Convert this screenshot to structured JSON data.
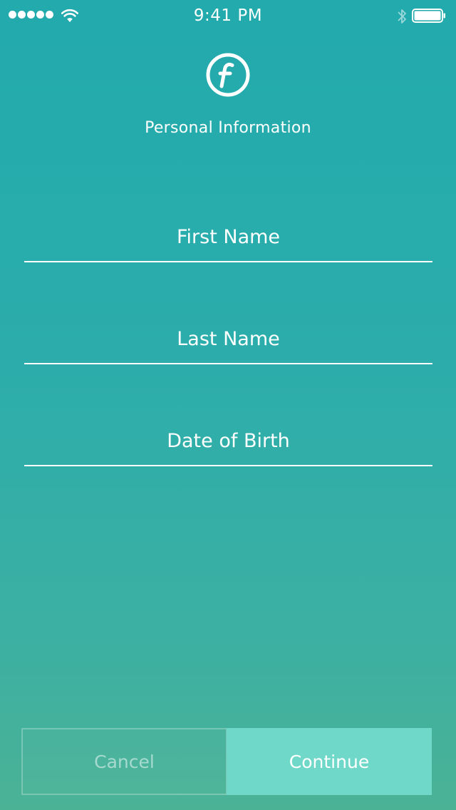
{
  "status_bar": {
    "time": "9:41 PM",
    "signal_icon": "signal-dots-icon",
    "wifi_icon": "wifi-icon",
    "bluetooth_icon": "bluetooth-icon",
    "battery_icon": "battery-icon"
  },
  "header": {
    "logo_icon": "f-circle-logo-icon",
    "title": "Personal Information"
  },
  "form": {
    "first_name": {
      "placeholder": "First Name",
      "value": ""
    },
    "last_name": {
      "placeholder": "Last Name",
      "value": ""
    },
    "date_of_birth": {
      "placeholder": "Date of Birth",
      "value": ""
    }
  },
  "actions": {
    "cancel_label": "Cancel",
    "continue_label": "Continue"
  },
  "colors": {
    "background_top": "#22aaad",
    "background_bottom": "#4bb295",
    "continue_button": "#6fd8c8",
    "text": "#ffffff"
  }
}
